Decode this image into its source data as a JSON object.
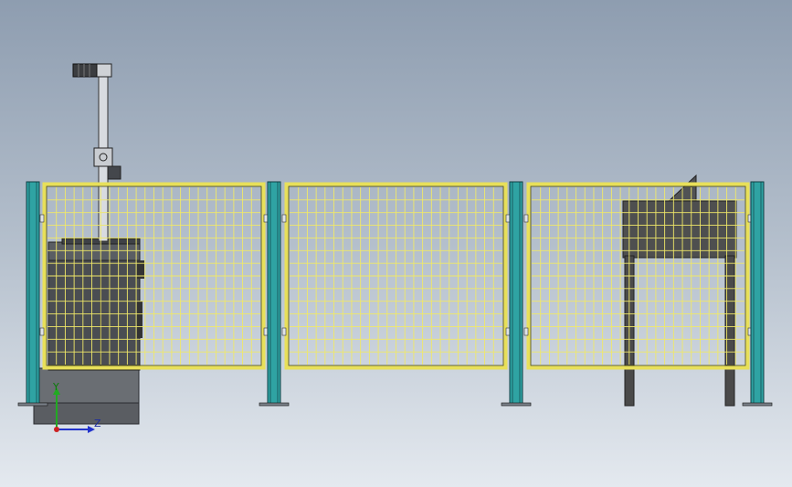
{
  "colors": {
    "post_fill": "#2fa3a3",
    "post_edge": "#0f3f44",
    "frame_fill": "#e8e05a",
    "frame_edge": "#4d4a10",
    "mesh_line": "#f0e868",
    "machine_dark": "#4a4d52",
    "machine_mid": "#60646a",
    "table_top": "#4e4f4f",
    "column": "#d8dbe0"
  },
  "icons": {
    "motor": "motor-icon",
    "axis_triad": "axis-triad-icon"
  },
  "axes": {
    "y_label": "Y",
    "z_label": "Z"
  },
  "scene": {
    "fence_panels": [
      "left",
      "center",
      "right"
    ],
    "posts": [
      "post-1",
      "post-2",
      "post-3",
      "post-4"
    ]
  }
}
